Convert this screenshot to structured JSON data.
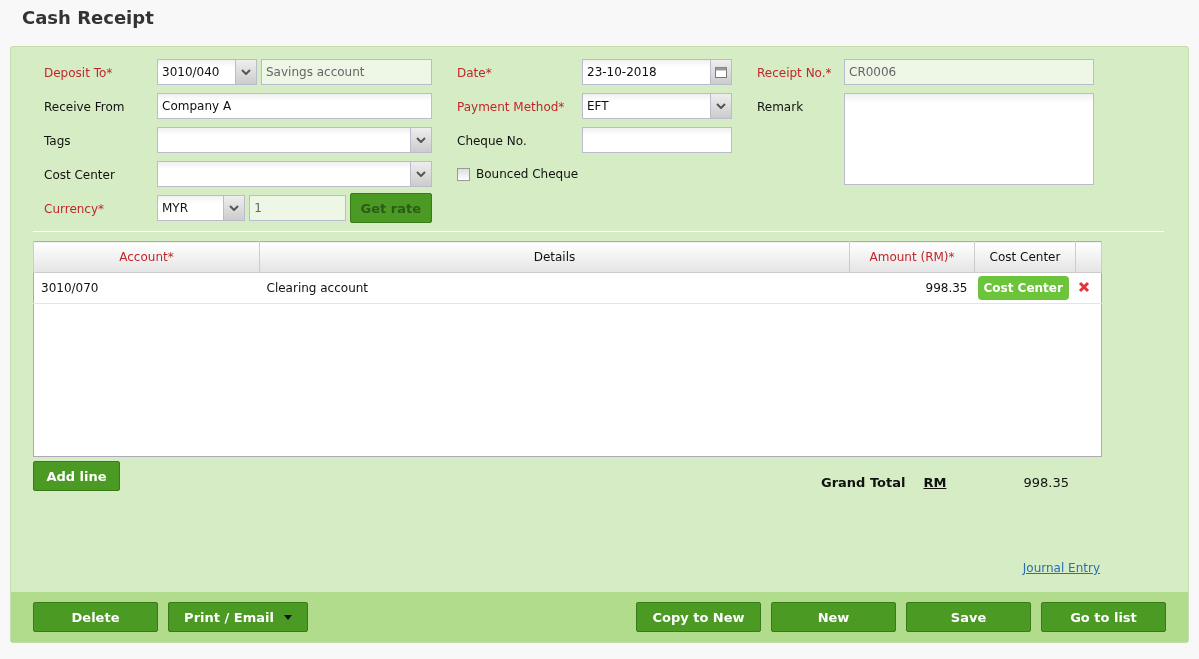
{
  "title": "Cash Receipt",
  "left_fields": [
    {
      "label": "Deposit To*",
      "required": true,
      "kind": "account",
      "value": "3010/040",
      "name": "Savings account"
    },
    {
      "label": "Receive From",
      "required": false,
      "kind": "text",
      "value": "Company A"
    },
    {
      "label": "Tags",
      "required": false,
      "kind": "select"
    },
    {
      "label": "Cost Center",
      "required": false,
      "kind": "select"
    },
    {
      "label": "Currency*",
      "required": true,
      "kind": "currency",
      "value": "MYR",
      "rate": "1",
      "button": {
        "label": "Get rate",
        "disabled": true
      }
    }
  ],
  "middle_fields": [
    {
      "label": "Date*",
      "required": true,
      "kind": "date",
      "value": "23-10-2018"
    },
    {
      "label": "Payment Method*",
      "required": true,
      "kind": "select",
      "value": "EFT"
    },
    {
      "label": "Cheque No.",
      "required": false,
      "kind": "text"
    },
    {
      "label": "Bounced Cheque",
      "required": false,
      "kind": "checkbox",
      "checked": false
    }
  ],
  "right_fields": [
    {
      "label": "Receipt No.*",
      "required": true,
      "kind": "readonly",
      "value": "CR0006"
    },
    {
      "label": "Remark",
      "required": false,
      "kind": "textarea"
    }
  ],
  "table": {
    "columns": [
      {
        "label": "Account*",
        "required": true
      },
      {
        "label": "Details",
        "required": false
      },
      {
        "label": "Amount (RM)*",
        "required": true
      },
      {
        "label": "Cost Center",
        "required": false
      }
    ],
    "rows": [
      {
        "account": "3010/070",
        "details": "Clearing account",
        "amount": "998.35",
        "cost_center": "Cost Center"
      }
    ]
  },
  "add_line": "Add line",
  "grand_total": {
    "label": "Grand Total",
    "currency": "RM",
    "value": "998.35"
  },
  "journal_link": "Journal Entry",
  "footer_left": [
    {
      "label": "Delete",
      "kind": "plain"
    },
    {
      "label": "Print / Email",
      "kind": "split"
    }
  ],
  "footer_right": [
    {
      "label": "Copy to New",
      "kind": "plain"
    },
    {
      "label": "New",
      "kind": "plain"
    },
    {
      "label": "Save",
      "kind": "plain"
    },
    {
      "label": "Go to list",
      "kind": "plain"
    }
  ]
}
